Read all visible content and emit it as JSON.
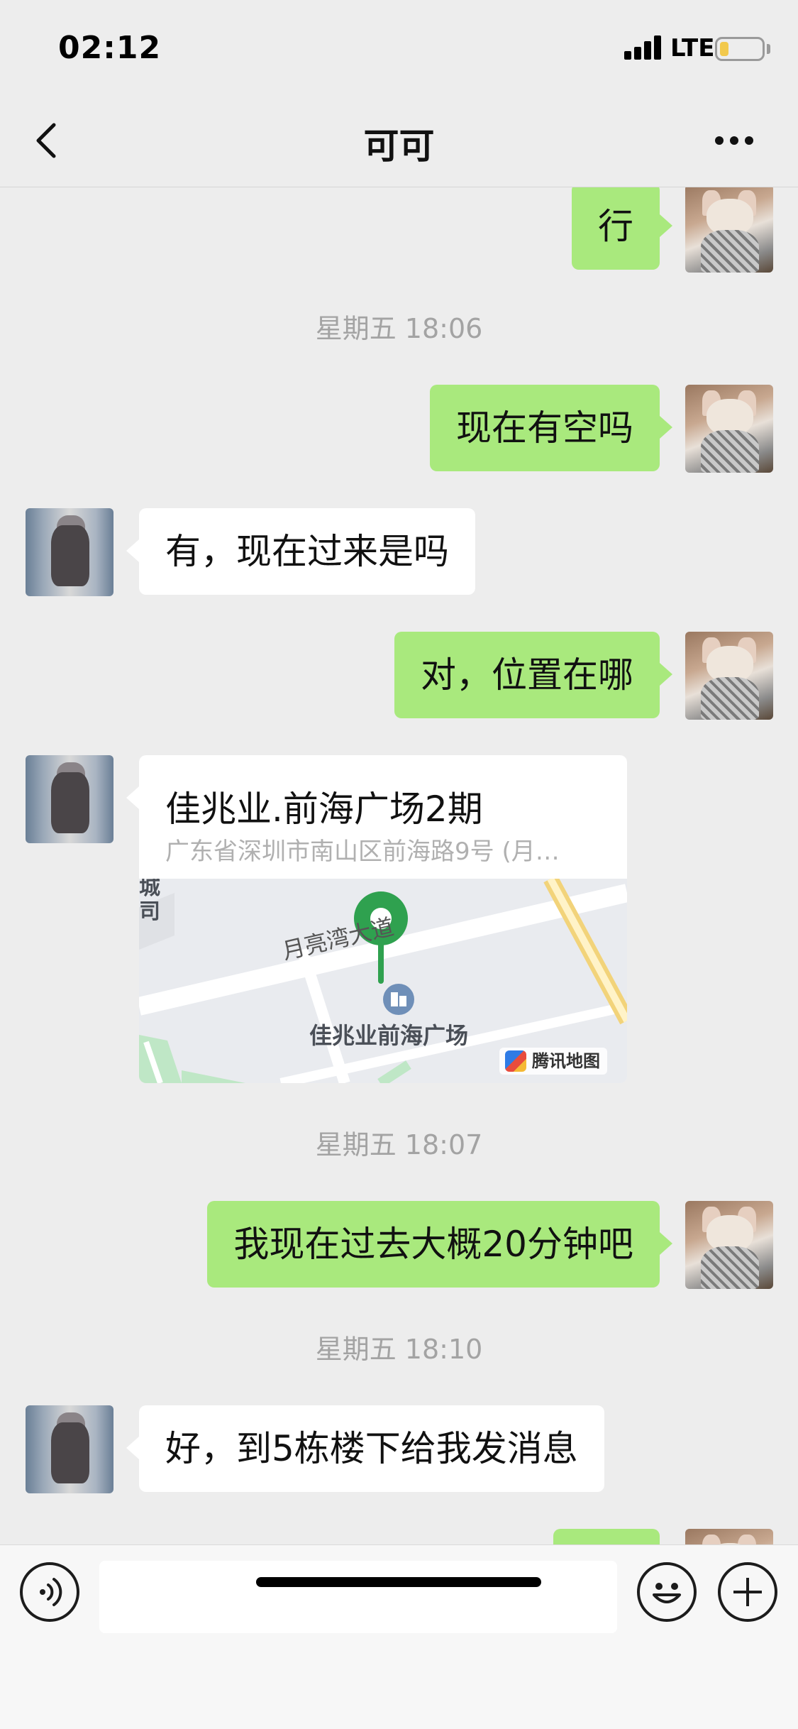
{
  "status_bar": {
    "time": "02:12",
    "network": "LTE",
    "icons": [
      "signal-icon",
      "battery-icon"
    ]
  },
  "nav": {
    "title": "可可",
    "icons": [
      "back-chevron-icon",
      "more-dots-icon"
    ]
  },
  "messages": [
    {
      "sender": "me",
      "type": "text",
      "text": "行"
    },
    {
      "type": "timestamp",
      "text": "星期五 18:06"
    },
    {
      "sender": "me",
      "type": "text",
      "text": "现在有空吗"
    },
    {
      "sender": "them",
      "type": "text",
      "text": "有，现在过来是吗"
    },
    {
      "sender": "me",
      "type": "text",
      "text": "对，位置在哪"
    },
    {
      "sender": "them",
      "type": "location",
      "name": "佳兆业.前海广场2期",
      "address": "广东省深圳市南山区前海路9号 (月…",
      "map_road_label": "月亮湾大道",
      "map_poi_label": "佳兆业前海广场",
      "map_edge_label": "城司",
      "map_provider": "腾讯地图"
    },
    {
      "type": "timestamp",
      "text": "星期五 18:07"
    },
    {
      "sender": "me",
      "type": "text",
      "text": "我现在过去大概20分钟吧"
    },
    {
      "type": "timestamp",
      "text": "星期五 18:10"
    },
    {
      "sender": "them",
      "type": "text",
      "text": "好，到5栋楼下给我发消息"
    }
  ],
  "input_bar": {
    "value": "",
    "icons": [
      "voice-icon",
      "emoji-icon",
      "plus-icon"
    ]
  },
  "colors": {
    "background": "#EDEDED",
    "my_bubble": "#A9E97D",
    "their_bubble": "#FFFFFF",
    "timestamp_text": "#A3A3A3",
    "map_pin": "#2FA14F"
  }
}
